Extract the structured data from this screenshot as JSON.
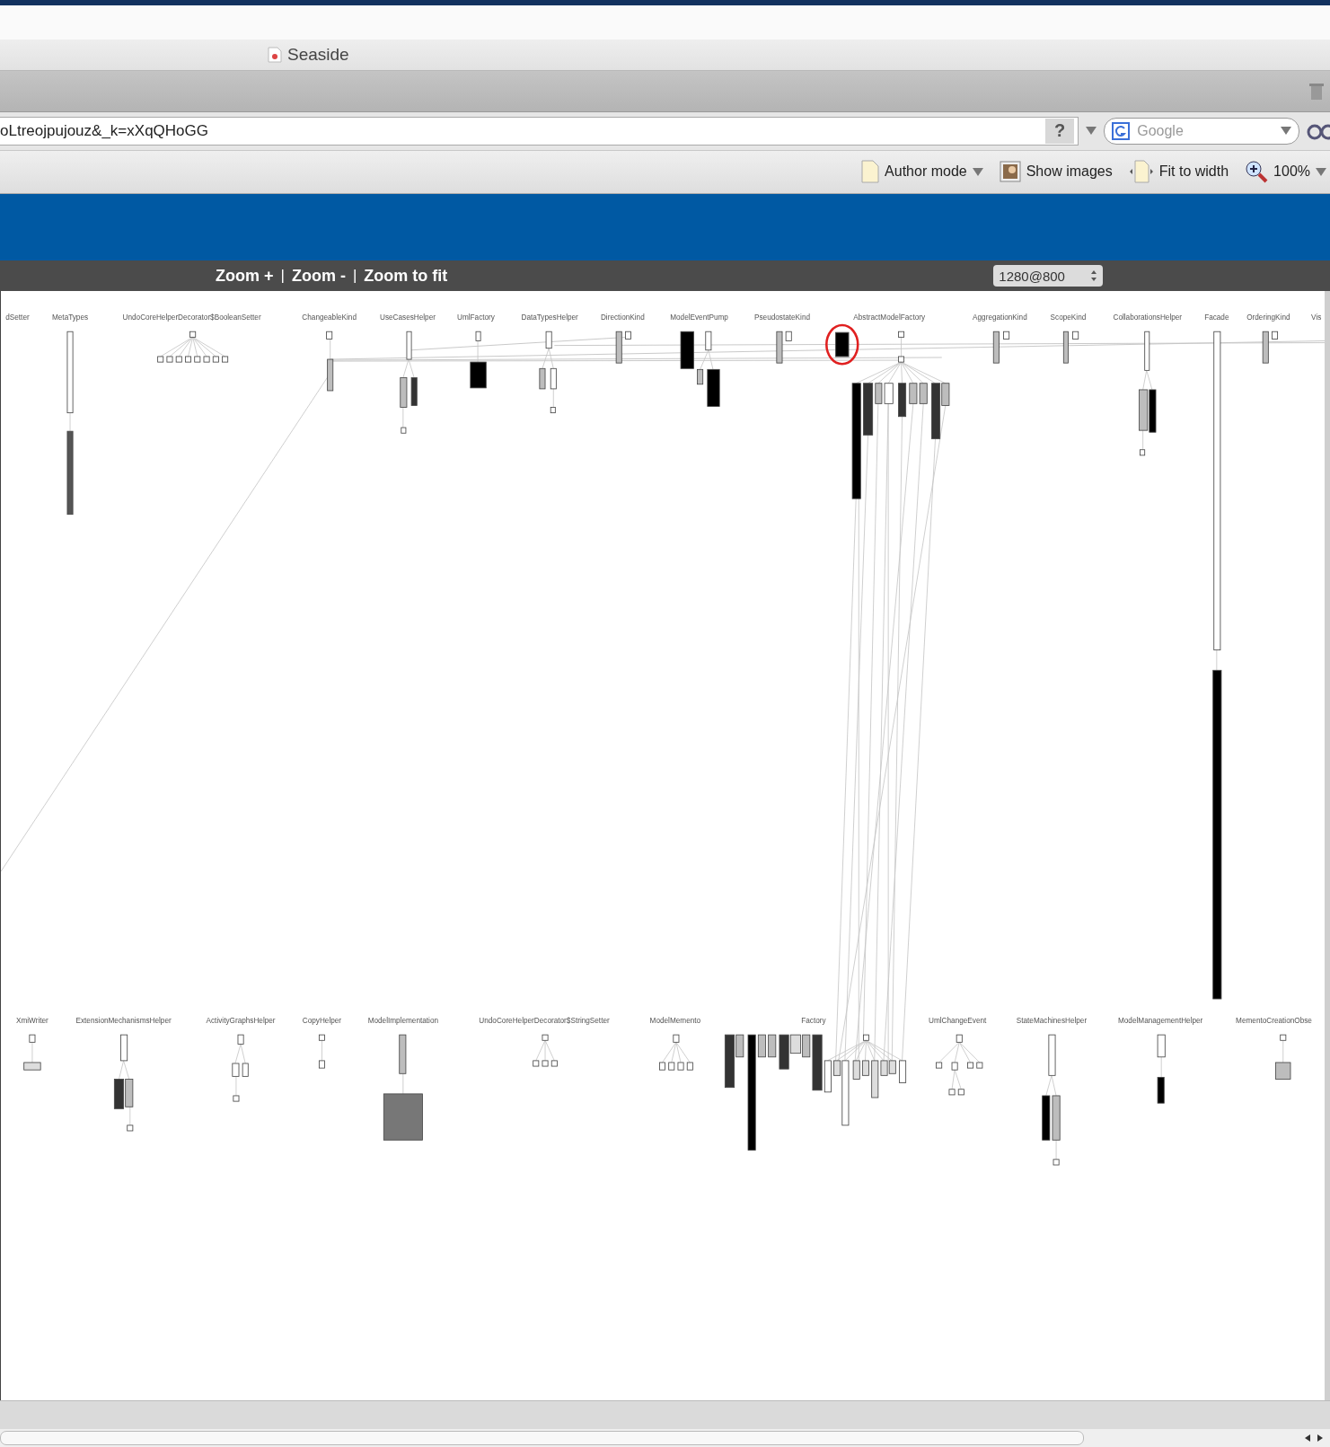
{
  "window": {
    "tab_title": "Seaside"
  },
  "address_bar": {
    "url": "oLtreojpujouz&_k=xXqQHoGG",
    "help": "?",
    "search": {
      "placeholder": "Google"
    }
  },
  "bookmarks": [
    {
      "label": "Author mode",
      "kind": "menu"
    },
    {
      "label": "Show images",
      "kind": "image"
    },
    {
      "label": "Fit to width",
      "kind": "page"
    },
    {
      "label": "100%",
      "kind": "zoom"
    }
  ],
  "zoom_bar": {
    "links": [
      "Zoom +",
      "Zoom -",
      "Zoom to fit"
    ],
    "separator": "|",
    "resolution": "1280@800"
  },
  "diagram": {
    "top_labels": [
      "dSetter",
      "MetaTypes",
      "UndoCoreHelperDecorator$BooleanSetter",
      "ChangeableKind",
      "UseCasesHelper",
      "UmlFactory",
      "DataTypesHelper",
      "DirectionKind",
      "ModelEventPump",
      "PseudostateKind",
      "AbstractModelFactory",
      "AggregationKind",
      "ScopeKind",
      "CollaborationsHelper",
      "Facade",
      "OrderingKind",
      "Vis"
    ],
    "bottom_labels": [
      "XmiWriter",
      "ExtensionMechanismsHelper",
      "ActivityGraphsHelper",
      "CopyHelper",
      "ModelImplementation",
      "UndoCoreHelperDecorator$StringSetter",
      "ModelMemento",
      "Factory",
      "UmlChangeEvent",
      "StateMachinesHelper",
      "ModelManagementHelper",
      "MementoCreationObse"
    ],
    "marked_node": {
      "highlighted": true
    }
  }
}
